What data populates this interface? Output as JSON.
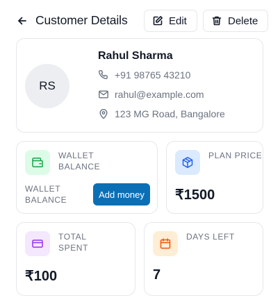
{
  "header": {
    "title": "Customer Details",
    "edit_label": "Edit",
    "delete_label": "Delete"
  },
  "customer": {
    "initials": "RS",
    "name": "Rahul Sharma",
    "phone": "+91 98765 43210",
    "email": "rahul@example.com",
    "address": "123 MG Road, Bangalore"
  },
  "wallet": {
    "label": "WALLET BALANCE",
    "sub_label": "WALLET BALANCE",
    "button_label": "Add money"
  },
  "plan": {
    "label": "PLAN PRICE",
    "value": "₹1500"
  },
  "spent": {
    "label": "TOTAL SPENT",
    "value": "₹100"
  },
  "days": {
    "label": "DAYS LEFT",
    "value": "7"
  },
  "colors": {
    "accent": "#0b6fb5",
    "wallet_bg": "#dcfce7",
    "wallet_fg": "#16a34a",
    "plan_bg": "#dbeafe",
    "plan_fg": "#2563eb",
    "spent_bg": "#f3e8ff",
    "spent_fg": "#9333ea",
    "days_bg": "#ffedd5",
    "days_fg": "#ea580c"
  }
}
